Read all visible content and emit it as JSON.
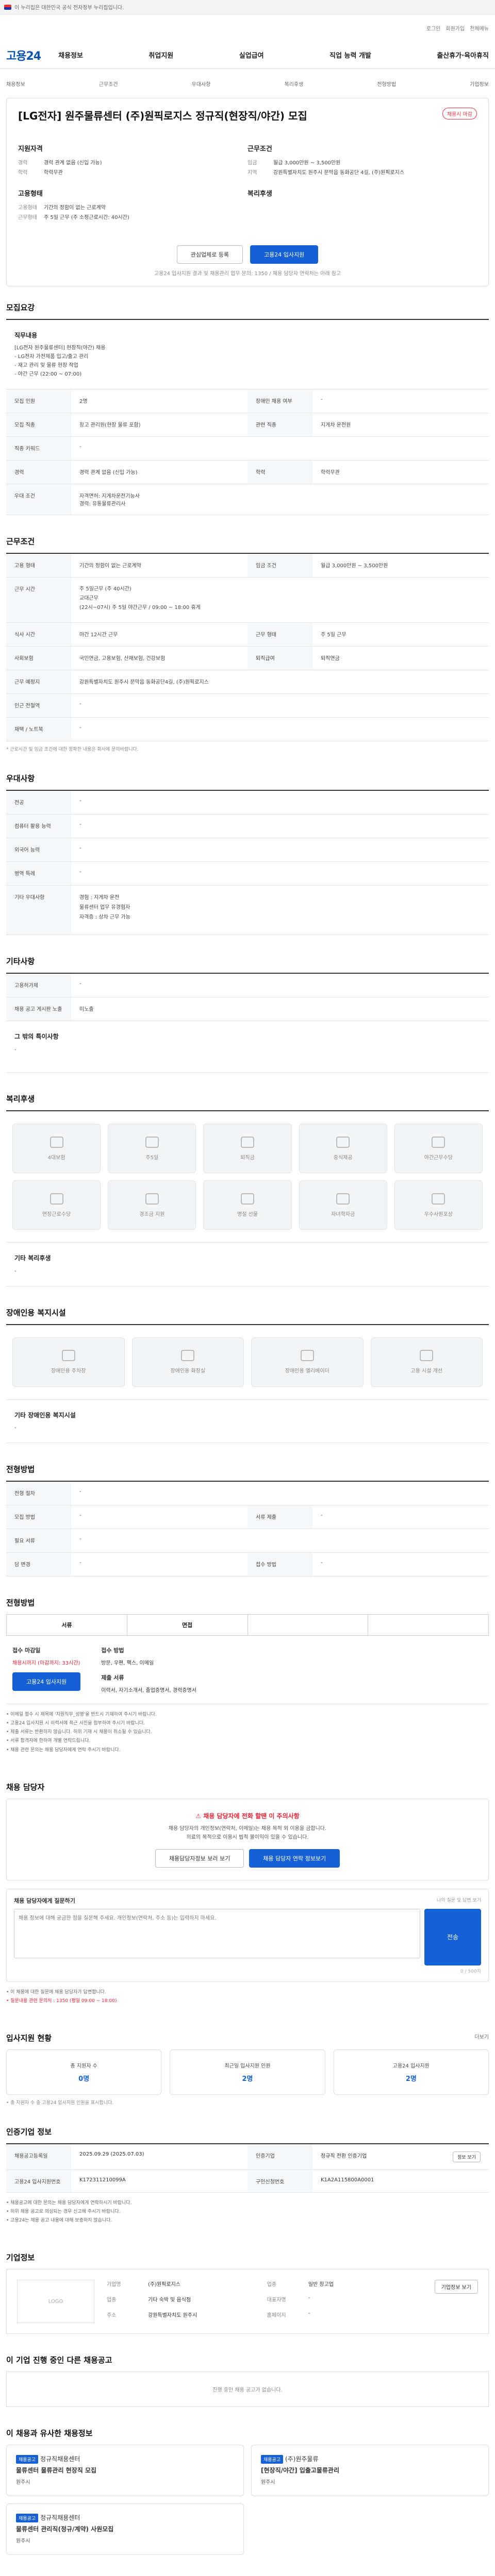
{
  "gov_banner": "이 누리집은 대한민국 공식 전자정부 누리집입니다.",
  "util": {
    "login": "로그인",
    "signup": "회원가입",
    "sitemap": "전체메뉴"
  },
  "logo": "고용24",
  "gnb": [
    "채용정보",
    "취업지원",
    "실업급여",
    "직업 능력 개발",
    "출산휴가·육아휴직"
  ],
  "breadcrumb": [
    "채용정보",
    "근무조건",
    "우대사항",
    "복리후생",
    "전형방법",
    "기업정보"
  ],
  "job": {
    "title": "[LG전자] 원주물류센터 (주)원픽로지스 정규직(현장직/야간) 모집",
    "badge": "채용시 마감",
    "qual_title": "지원자격",
    "qual": [
      [
        "경력",
        "경력 관계 없음 (신입 가능)"
      ],
      [
        "학력",
        "학력무관"
      ]
    ],
    "cond_title": "근무조건",
    "cond": [
      [
        "임금",
        "월급 3,000만원 ~ 3,500만원"
      ],
      [
        "지역",
        "강원특별자치도 원주시 문막읍 동화공단 4길, (주)원픽로지스"
      ]
    ],
    "form_title": "고용형태",
    "form": [
      [
        "고용형태",
        "기간의 정함이 없는 근로계약"
      ],
      [
        "근무형태",
        "주 5일 근무 (주 소정근로시간: 40시간)"
      ]
    ],
    "welfare_title": "복리후생",
    "btn_interest": "관심업체로 등록",
    "btn_apply": "고용24 입사지원",
    "note": "고용24 입사지원 결과 및 채용관리 업무 문의: 1350 / 채용 담당자 연락처는 아래 참고"
  },
  "recruit": {
    "title": "모집요강",
    "duty_h": "직무내용",
    "duty_main": "[LG전자 원주물류센터] 현장직(야간) 채용",
    "duty_lines": [
      "- LG전자 가전제품 입고/출고 관리",
      "- 재고 관리 및 물류 현장 작업",
      "- 야간 근무 (22:00 ~ 07:00)"
    ],
    "rows": [
      [
        "모집 인원",
        "2명",
        "장애인 채용 여부",
        "-"
      ],
      [
        "모집 직종",
        "창고 관리원(현장 물류 포함)",
        "관련 직종",
        "지게차 운전원"
      ],
      [
        "직종 키워드",
        "-",
        "",
        ""
      ],
      [
        "경력",
        "경력 관계 없음 (신입 가능)",
        "학력",
        "학력무관"
      ],
      [
        "우대 조건",
        "자격면허: 지게차운전기능사\n경력: 유통물류관리사",
        "",
        ""
      ]
    ]
  },
  "work": {
    "title": "근무조건",
    "rows": [
      [
        "고용 형태",
        "기간의 정함이 없는 근로계약",
        "임금 조건",
        "월급 3,000만원 ~ 3,500만원"
      ],
      [
        "근무 시간",
        "주 5일근무 (주 40시간)\n교대근무\n(22시~07시) 주 5일 야간근무 / 09:00 ~ 18:00 휴게",
        "",
        ""
      ],
      [
        "식사 시간",
        "야간 12시간 근무",
        "근무 형태",
        "주 5일 근무"
      ],
      [
        "사회보험",
        "국민연금, 고용보험, 산재보험, 건강보험",
        "퇴직급여",
        "퇴직연금"
      ],
      [
        "근무 예정지",
        "강원특별자치도 원주시 문막읍 동화공단4길, (주)원픽로지스",
        "",
        ""
      ],
      [
        "인근 전철역",
        "-",
        "",
        ""
      ],
      [
        "재택 / 노트북",
        "-",
        "",
        ""
      ]
    ],
    "note": "* 근로시간 및 임금 조건에 대한 정확한 내용은 회사에 문의바랍니다."
  },
  "prefer": {
    "title": "우대사항",
    "rows": [
      [
        "전공",
        "-"
      ],
      [
        "컴퓨터 활용 능력",
        "-"
      ],
      [
        "외국어 능력",
        "-"
      ],
      [
        "병역 특례",
        "-"
      ],
      [
        "기타 우대사항",
        "경험 : 지게차 운전\n물류센터 업무 유경험자\n자격증 : 상차 근무 가능"
      ]
    ]
  },
  "other": {
    "title": "기타사항",
    "rows": [
      [
        "고용허가제",
        "-"
      ],
      [
        "채용 공고 게시판 노출",
        "미노출"
      ]
    ],
    "extra_h": "그 밖의 특이사항",
    "extra": "-"
  },
  "welfare": {
    "title": "복리후생",
    "chips": [
      "4대보험",
      "주5일",
      "퇴직금",
      "중식제공",
      "야간근무수당",
      "연장근로수당",
      "경조금 지원",
      "명절 선물",
      "자녀학자금",
      "우수사원포상"
    ],
    "extra_h": "기타 복리후생",
    "extra": "-"
  },
  "disabled": {
    "title": "장애인용 복지시설",
    "chips": [
      "장애인용 주차장",
      "장애인용 화장실",
      "장애인용 엘리베이터",
      "고용 시설 개선"
    ],
    "extra_h": "기타 장애인용 복지시설",
    "extra": "-"
  },
  "process": {
    "title": "전형방법",
    "rows": [
      [
        "전형 절차",
        "-",
        "",
        ""
      ],
      [
        "모집 방법",
        "-",
        "서류 제출",
        "-"
      ],
      [
        "필요 서류",
        "-",
        "",
        ""
      ],
      [
        "담 변경",
        "-",
        "접수 방법",
        "-"
      ]
    ]
  },
  "apply_method": {
    "title": "전형방법",
    "steps": [
      "서류",
      "면접",
      "",
      ""
    ],
    "a1_t": "접수 마감일",
    "a1_v": "채용시까지 (마감까지: 33시간)",
    "a1_btn": "고용24 입사지원",
    "a2_t": "접수 방법",
    "a2_v": "방문, 우편, 팩스, 이메일",
    "a3_t": "제출 서류",
    "a3_v": "이력서, 자기소개서, 졸업증명서, 경력증명서",
    "bullets": [
      "• 이메일 접수 시 제목에 '지원직무_성명'을 반드시 기재하여 주시기 바랍니다.",
      "• 고용24 입사지원 시 이력서에 최근 사진을 첨부하여 주시기 바랍니다.",
      "• 제출 서류는 반환하지 않습니다. 허위 기재 시 채용이 취소될 수 있습니다.",
      "• 서류 합격자에 한하여 개별 연락드립니다.",
      "• 채용 관련 문의는 채용 담당자에게 연락 주시기 바랍니다."
    ]
  },
  "contact": {
    "title": "채용 담당자",
    "alert_t": "채용 담당자에 전화 할땐 이 주의사항",
    "alert_d": "채용 담당자의 개인정보(연락처, 이메일)는 채용 목적 외 이용을 금합니다.\n의료의 목적으로 이용시 법적 불이익이 있을 수 있습니다.",
    "b1": "채용담당자정보 보러 보기",
    "b2": "채용 담당자 연락 정보보기",
    "q_h": "채용 담당자에게 질문하기",
    "q_note": "나의 질문 및 답변 보기",
    "q_ph": "채용 정보에 대해 궁금한 점을 질문해 주세요. 개인정보(연락처, 주소 등)는 입력하지 마세요.",
    "q_btn": "전송",
    "q_count": "0 / 500자",
    "bullets": [
      "• 이 채용에 대한 질문에 채용 담당자가 답변합니다.",
      "• 질문내용 관련 문의처 : 1350 (평일 09:00 ~ 18:00)"
    ]
  },
  "status": {
    "title": "입사지원 현황",
    "more": "더보기",
    "stats": [
      [
        "총 지원자 수",
        "0명"
      ],
      [
        "최근일 입사지원 인원",
        "2명"
      ],
      [
        "고용24 입사지원",
        "2명"
      ]
    ],
    "note": "• 총 지원자 수 중 고용24 입사지원 인원을 표시합니다."
  },
  "info": {
    "title": "인증기업 정보",
    "btn": "정보 보기",
    "rows": [
      [
        "채용공고등록일",
        "2025.09.29 (2025.07.03)",
        "인증기업",
        "정규직 전환 인증기업"
      ],
      [
        "고용24 입사지원번호",
        "K172311210099A",
        "구인신청번호",
        "K1A2A115800A0001"
      ]
    ],
    "bullets": [
      "• 채용공고에 대한 문의는 채용 담당자에게 연락하시기 바랍니다.",
      "• 허위 채용 공고로 의심되는 경우 신고해 주시기 바랍니다.",
      "• 고용24는 채용 공고 내용에 대해 보증하지 않습니다."
    ]
  },
  "company": {
    "title": "기업정보",
    "btn": "기업정보 보기",
    "logo": "LOGO",
    "rows": [
      [
        "기업명",
        "(주)원픽로지스",
        "업종",
        "일반 창고업"
      ],
      [
        "업종",
        "기타 숙박 및 음식점",
        "대표자명",
        "-"
      ],
      [
        "주소",
        "강원특별자치도 원주시",
        "홈페이지",
        "-"
      ]
    ]
  },
  "other_jobs": {
    "title": "이 기업 진행 중인 다른 채용공고",
    "empty": "진행 중인 채용 공고가 없습니다."
  },
  "recs": {
    "title": "이 채용과 유사한 채용정보",
    "items": [
      {
        "tag": "채용공고",
        "co": "정규직채용센터",
        "name": "물류센터 물류관리 현장직 모집",
        "loc": "원주시"
      },
      {
        "tag": "채용공고",
        "co": "(주)원주물류",
        "name": "[현장직/야간] 입출고물류관리",
        "loc": "원주시"
      },
      {
        "tag": "채용공고",
        "co": "정규직채용센터",
        "name": "물류센터 관리직(정규/계약) 사원모집",
        "loc": "원주시"
      }
    ]
  }
}
